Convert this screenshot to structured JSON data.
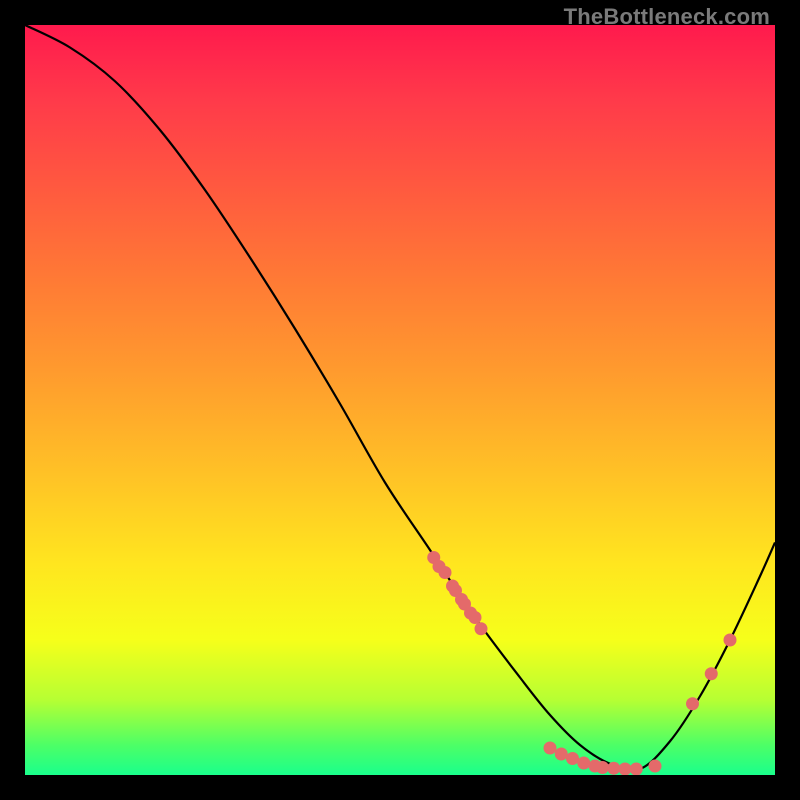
{
  "watermark": "TheBottleneck.com",
  "chart_data": {
    "type": "line",
    "title": "",
    "xlabel": "",
    "ylabel": "",
    "xlim": [
      0,
      100
    ],
    "ylim": [
      0,
      100
    ],
    "grid": false,
    "legend": false,
    "background_gradient": [
      "#ff1a4d",
      "#ffe61f",
      "#1aff8c"
    ],
    "series": [
      {
        "name": "curve",
        "type": "line",
        "color": "#000000",
        "x": [
          0,
          6,
          12,
          18,
          24,
          30,
          36,
          42,
          48,
          54,
          60,
          66,
          70,
          74,
          78,
          82,
          86,
          90,
          94,
          98,
          100
        ],
        "values": [
          100,
          97,
          92.5,
          86,
          78,
          69,
          59.5,
          49.5,
          39,
          30,
          21,
          13,
          8,
          4,
          1.5,
          0.8,
          4.5,
          10.5,
          18,
          26.5,
          31
        ]
      },
      {
        "name": "left-cluster-points",
        "type": "scatter",
        "color": "#e46a6a",
        "x": [
          54.5,
          55.2,
          56.0,
          57.0,
          57.4,
          58.2,
          58.6,
          59.4,
          60.0,
          60.8
        ],
        "values": [
          29.0,
          27.8,
          27.0,
          25.2,
          24.6,
          23.4,
          22.8,
          21.6,
          21.0,
          19.5
        ]
      },
      {
        "name": "bottom-cluster-points",
        "type": "scatter",
        "color": "#e46a6a",
        "x": [
          70.0,
          71.5,
          73.0,
          74.5,
          76.0,
          77.0,
          78.5,
          80.0,
          81.5,
          84.0
        ],
        "values": [
          3.6,
          2.8,
          2.2,
          1.6,
          1.2,
          1.0,
          0.9,
          0.8,
          0.8,
          1.2
        ]
      },
      {
        "name": "right-cluster-points",
        "type": "scatter",
        "color": "#e46a6a",
        "x": [
          89.0,
          91.5,
          94.0
        ],
        "values": [
          9.5,
          13.5,
          18.0
        ]
      }
    ]
  }
}
